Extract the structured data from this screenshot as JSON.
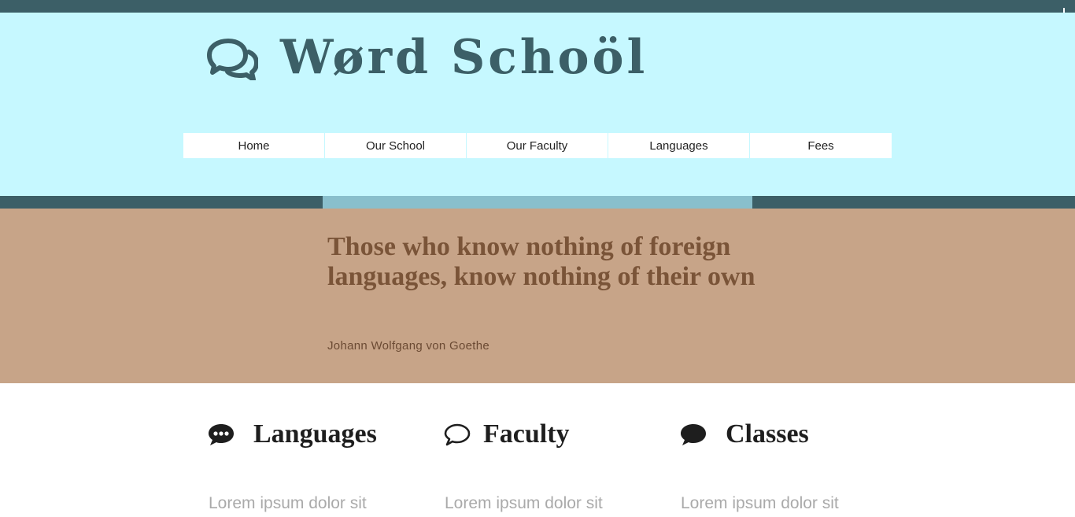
{
  "header": {
    "logo_text": "Wørd Schoöl",
    "logo_icon": "chat-bubbles-icon"
  },
  "nav": {
    "items": [
      {
        "label": "Home"
      },
      {
        "label": "Our School"
      },
      {
        "label": "Our Faculty"
      },
      {
        "label": "Languages"
      },
      {
        "label": "Fees"
      }
    ]
  },
  "quote": {
    "text": "Those who know nothing of foreign languages, know nothing of their own",
    "author": "Johann Wolfgang von Goethe"
  },
  "features": [
    {
      "icon": "chat-bubble-dots-icon",
      "title": "Languages",
      "body": "Lorem ipsum dolor sit"
    },
    {
      "icon": "chat-bubble-outline-icon",
      "title": "Faculty",
      "body": "Lorem ipsum dolor sit"
    },
    {
      "icon": "chat-bubble-filled-icon",
      "title": "Classes",
      "body": "Lorem ipsum dolor sit"
    }
  ],
  "colors": {
    "dark_teal": "#3c5f67",
    "light_cyan": "#c6f8ff",
    "accent_blue": "#89bfcc",
    "quote_bg": "#c7a488",
    "quote_text": "#7a5438"
  }
}
